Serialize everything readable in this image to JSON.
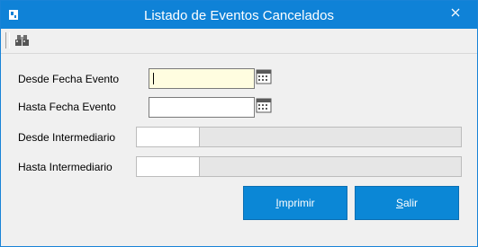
{
  "window": {
    "title": "Listado de Eventos Cancelados",
    "titlebar_color": "#0f82d7"
  },
  "toolbar": {
    "find_icon": "binoculars-icon"
  },
  "form": {
    "desde_fecha_label": "Desde Fecha Evento",
    "desde_fecha_value": "",
    "hasta_fecha_label": "Hasta Fecha Evento",
    "hasta_fecha_value": "",
    "desde_inter_label": "Desde Intermediario",
    "desde_inter_code": "",
    "desde_inter_desc": "",
    "hasta_inter_label": "Hasta Intermediario",
    "hasta_inter_code": "",
    "hasta_inter_desc": ""
  },
  "buttons": {
    "imprimir_mnemonic": "I",
    "imprimir_rest": "mprimir",
    "salir_mnemonic": "S",
    "salir_rest": "alir",
    "color": "#0b87d6"
  }
}
